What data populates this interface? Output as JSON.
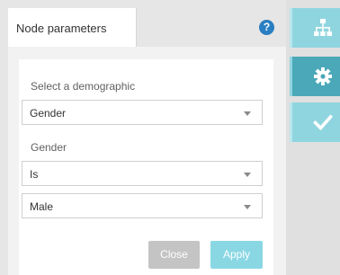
{
  "colors": {
    "accent": "#8ad7e4",
    "accent_dark": "#4aa8b8",
    "help_blue": "#2a7ec2",
    "close_grey": "#c4c4c4"
  },
  "tab": {
    "title": "Node parameters",
    "help_icon": "question-circle-icon"
  },
  "form": {
    "demographic_label": "Select a demographic",
    "demographic_value": "Gender",
    "gender_label": "Gender",
    "operator_value": "Is",
    "gender_value": "Male"
  },
  "buttons": {
    "close": "Close",
    "apply": "Apply"
  },
  "sidebar": {
    "items": [
      {
        "icon": "sitemap-icon",
        "active": false
      },
      {
        "icon": "gear-icon",
        "active": true
      },
      {
        "icon": "checkmark-icon",
        "active": false
      }
    ]
  }
}
